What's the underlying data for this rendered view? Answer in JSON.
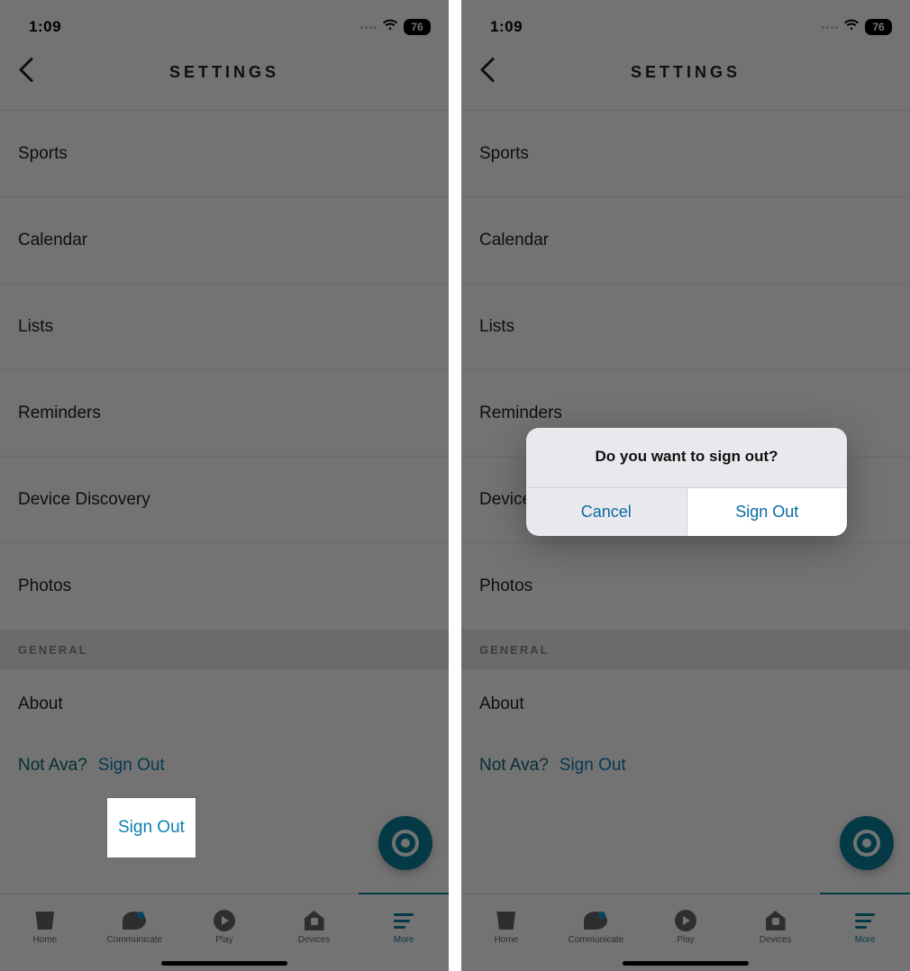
{
  "status": {
    "time": "1:09",
    "battery": "76"
  },
  "header": {
    "title": "SETTINGS"
  },
  "settings_rows": {
    "sports": "Sports",
    "calendar": "Calendar",
    "lists": "Lists",
    "reminders": "Reminders",
    "device_discovery": "Device Discovery",
    "photos": "Photos"
  },
  "section": {
    "general": "GENERAL"
  },
  "about_row": "About",
  "signout": {
    "not_user": "Not Ava?",
    "link": "Sign Out"
  },
  "tabs": {
    "home": "Home",
    "communicate": "Communicate",
    "play": "Play",
    "devices": "Devices",
    "more": "More"
  },
  "modal": {
    "title": "Do you want to sign out?",
    "cancel": "Cancel",
    "confirm": "Sign Out"
  }
}
